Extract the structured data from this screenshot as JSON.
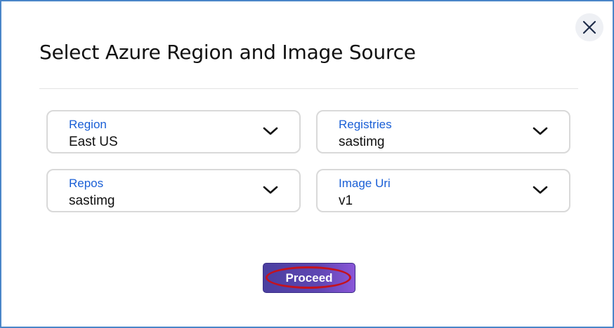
{
  "dialog": {
    "title": "Select Azure Region and Image Source",
    "close_icon": "close-icon"
  },
  "fields": {
    "region": {
      "label": "Region",
      "value": "East US"
    },
    "registries": {
      "label": "Registries",
      "value": "sastimg"
    },
    "repos": {
      "label": "Repos",
      "value": "sastimg"
    },
    "image_uri": {
      "label": "Image Uri",
      "value": "v1"
    }
  },
  "actions": {
    "proceed_label": "Proceed"
  },
  "colors": {
    "border": "#4a86c8",
    "label": "#1a5fd6",
    "button": "#5e46b2",
    "highlight_ring": "#c4121e"
  }
}
